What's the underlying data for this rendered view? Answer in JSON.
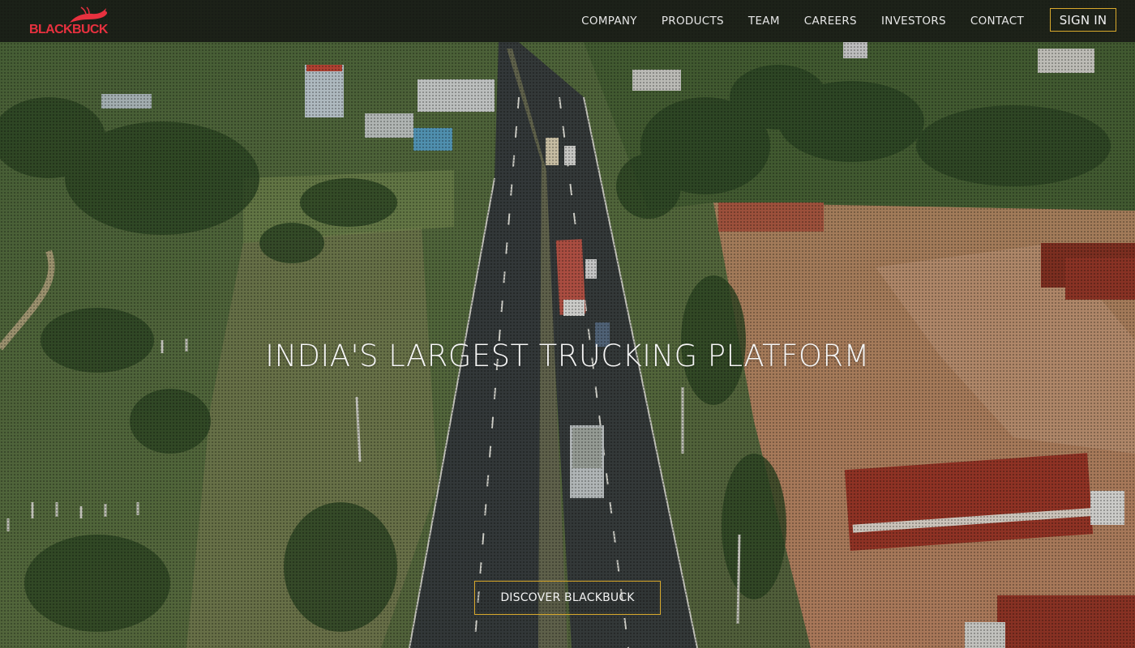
{
  "brand": {
    "logo_text": "BLACKBUCK",
    "logo_color": "#e8313f"
  },
  "nav": {
    "items": [
      {
        "label": "COMPANY"
      },
      {
        "label": "PRODUCTS"
      },
      {
        "label": "TEAM"
      },
      {
        "label": "CAREERS"
      },
      {
        "label": "INVESTORS"
      },
      {
        "label": "CONTACT"
      }
    ],
    "signin_label": "SIGN IN"
  },
  "hero": {
    "title": "INDIA'S LARGEST TRUCKING PLATFORM",
    "cta_label": "DISCOVER BLACKBUCK",
    "accent_color": "#d9a92c"
  },
  "icons": [
    "blackbuck-antelope-icon"
  ]
}
